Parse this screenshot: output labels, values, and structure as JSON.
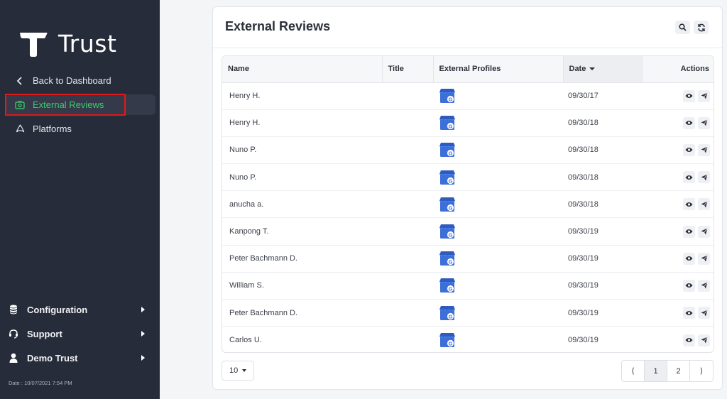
{
  "brand": {
    "name": "Trust"
  },
  "sidebar": {
    "nav": [
      {
        "label": "Back to Dashboard",
        "icon": "chevron-left-icon"
      },
      {
        "label": "External Reviews",
        "icon": "review-icon",
        "active": true
      },
      {
        "label": "Platforms",
        "icon": "platforms-icon"
      }
    ],
    "bottom": [
      {
        "label": "Configuration",
        "icon": "database-icon"
      },
      {
        "label": "Support",
        "icon": "headset-icon"
      },
      {
        "label": "Demo Trust",
        "icon": "user-icon"
      }
    ],
    "date_text": "Date : 10/07/2021 7:54 PM"
  },
  "main": {
    "title": "External Reviews",
    "columns": [
      "Name",
      "Title",
      "External Profiles",
      "Date",
      "Actions"
    ],
    "sorted_column": "Date",
    "rows": [
      {
        "name": "Henry H.",
        "title": "",
        "profile": "google-my-business",
        "date": "09/30/17"
      },
      {
        "name": "Henry H.",
        "title": "",
        "profile": "google-my-business",
        "date": "09/30/18"
      },
      {
        "name": "Nuno P.",
        "title": "",
        "profile": "google-my-business",
        "date": "09/30/18"
      },
      {
        "name": "Nuno P.",
        "title": "",
        "profile": "google-my-business",
        "date": "09/30/18"
      },
      {
        "name": "anucha a.",
        "title": "",
        "profile": "google-my-business",
        "date": "09/30/18"
      },
      {
        "name": "Kanpong T.",
        "title": "",
        "profile": "google-my-business",
        "date": "09/30/19"
      },
      {
        "name": "Peter Bachmann D.",
        "title": "",
        "profile": "google-my-business",
        "date": "09/30/19"
      },
      {
        "name": "William S.",
        "title": "",
        "profile": "google-my-business",
        "date": "09/30/19"
      },
      {
        "name": "Peter Bachmann D.",
        "title": "",
        "profile": "google-my-business",
        "date": "09/30/19"
      },
      {
        "name": "Carlos U.",
        "title": "",
        "profile": "google-my-business",
        "date": "09/30/19"
      }
    ],
    "page_size": "10",
    "pagination": {
      "prev": "⟨",
      "pages": [
        "1",
        "2"
      ],
      "current": "1",
      "next": "⟩"
    }
  },
  "colors": {
    "sidebar_bg": "#272c3a",
    "accent": "#3ecb6c",
    "highlight": "#e11919"
  }
}
